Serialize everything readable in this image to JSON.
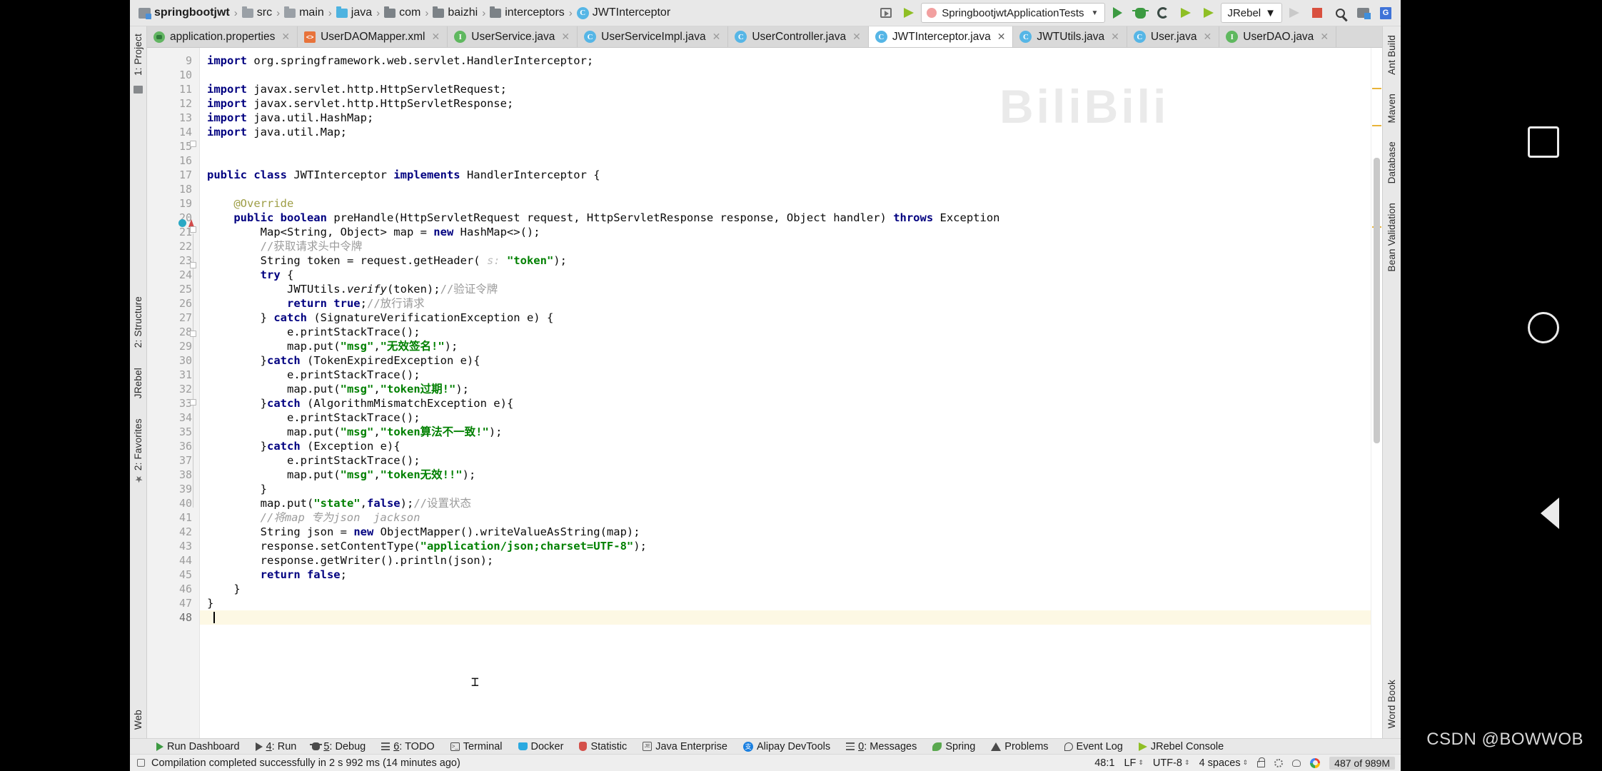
{
  "window": {
    "watermark": "CSDN @BOWWOB",
    "bg_watermark": "BiliBili"
  },
  "navbar": {
    "breadcrumbs": [
      {
        "label": "springbootjwt",
        "icon": "module-icon",
        "bold": true
      },
      {
        "label": "src",
        "icon": "folder-icon"
      },
      {
        "label": "main",
        "icon": "folder-icon"
      },
      {
        "label": "java",
        "icon": "source-folder-icon"
      },
      {
        "label": "com",
        "icon": "package-folder-icon"
      },
      {
        "label": "baizhi",
        "icon": "package-folder-icon"
      },
      {
        "label": "interceptors",
        "icon": "package-folder-icon"
      },
      {
        "label": "JWTInterceptor",
        "icon": "class-icon"
      }
    ],
    "separator": "›",
    "run_config": "SpringbootjwtApplicationTests",
    "jrebel_label": "JRebel",
    "buttons": [
      "run-window-icon",
      "build-hammer-icon",
      "run-icon",
      "debug-icon",
      "coverage-icon",
      "jrebel-run-icon",
      "jrebel-debug-icon",
      "stop-icon-disabled",
      "stop-icon",
      "search-everywhere-icon",
      "project-structure-icon",
      "google-translate-icon"
    ]
  },
  "editor_tabs": [
    {
      "label": "application.properties",
      "icon": "properties-file-icon",
      "active": false,
      "closable": true
    },
    {
      "label": "UserDAOMapper.xml",
      "icon": "xml-file-icon",
      "active": false,
      "closable": true
    },
    {
      "label": "UserService.java",
      "icon": "interface-icon",
      "active": false,
      "closable": true
    },
    {
      "label": "UserServiceImpl.java",
      "icon": "class-icon",
      "active": false,
      "closable": true
    },
    {
      "label": "UserController.java",
      "icon": "class-icon",
      "active": false,
      "closable": true
    },
    {
      "label": "JWTInterceptor.java",
      "icon": "class-icon",
      "active": true,
      "closable": true
    },
    {
      "label": "JWTUtils.java",
      "icon": "class-icon",
      "active": false,
      "closable": true
    },
    {
      "label": "User.java",
      "icon": "class-icon",
      "active": false,
      "closable": true
    },
    {
      "label": "UserDAO.java",
      "icon": "interface-icon",
      "active": false,
      "closable": true
    }
  ],
  "left_tool_strip": {
    "top": [
      "1: Project"
    ],
    "middle": [
      "2: Structure",
      "JRebel",
      "2: Favorites"
    ],
    "bottom": [
      "Web"
    ]
  },
  "right_tool_strip": {
    "top": [
      "Ant Build",
      "Maven",
      "Database",
      "Bean Validation"
    ],
    "bottom": [
      "Word Book"
    ]
  },
  "editor": {
    "first_line": 9,
    "caret_line": 48,
    "lines": [
      {
        "n": 9,
        "tokens": [
          {
            "t": "import",
            "c": "kw"
          },
          {
            "t": " org.springframework.web.servlet.HandlerInterceptor;",
            "c": ""
          }
        ]
      },
      {
        "n": 10,
        "tokens": []
      },
      {
        "n": 11,
        "tokens": [
          {
            "t": "import",
            "c": "kw"
          },
          {
            "t": " javax.servlet.http.HttpServletRequest;",
            "c": ""
          }
        ]
      },
      {
        "n": 12,
        "tokens": [
          {
            "t": "import",
            "c": "kw"
          },
          {
            "t": " javax.servlet.http.HttpServletResponse;",
            "c": ""
          }
        ]
      },
      {
        "n": 13,
        "tokens": [
          {
            "t": "import",
            "c": "kw"
          },
          {
            "t": " java.util.HashMap;",
            "c": ""
          }
        ]
      },
      {
        "n": 14,
        "tokens": [
          {
            "t": "import",
            "c": "kw"
          },
          {
            "t": " java.util.Map;",
            "c": ""
          }
        ]
      },
      {
        "n": 15,
        "tokens": []
      },
      {
        "n": 16,
        "tokens": []
      },
      {
        "n": 17,
        "tokens": [
          {
            "t": "public class",
            "c": "kw"
          },
          {
            "t": " JWTInterceptor ",
            "c": ""
          },
          {
            "t": "implements",
            "c": "kw"
          },
          {
            "t": " HandlerInterceptor {",
            "c": ""
          }
        ]
      },
      {
        "n": 18,
        "tokens": []
      },
      {
        "n": 19,
        "tokens": [
          {
            "t": "    @Override",
            "c": "anno"
          }
        ]
      },
      {
        "n": 20,
        "tokens": [
          {
            "t": "    ",
            "c": ""
          },
          {
            "t": "public boolean",
            "c": "kw"
          },
          {
            "t": " preHandle(HttpServletRequest request, HttpServletResponse response, Object handler) ",
            "c": ""
          },
          {
            "t": "throws",
            "c": "kw"
          },
          {
            "t": " Exception",
            "c": ""
          }
        ]
      },
      {
        "n": 21,
        "tokens": [
          {
            "t": "        Map<String, Object> map = ",
            "c": ""
          },
          {
            "t": "new",
            "c": "kw"
          },
          {
            "t": " HashMap<>();",
            "c": ""
          }
        ]
      },
      {
        "n": 22,
        "tokens": [
          {
            "t": "        //获取请求头中令牌",
            "c": "cmt"
          }
        ]
      },
      {
        "n": 23,
        "tokens": [
          {
            "t": "        String token = request.getHeader( ",
            "c": ""
          },
          {
            "t": "s:",
            "c": "hint"
          },
          {
            "t": " ",
            "c": ""
          },
          {
            "t": "\"token\"",
            "c": "str"
          },
          {
            "t": ");",
            "c": ""
          }
        ]
      },
      {
        "n": 24,
        "tokens": [
          {
            "t": "        ",
            "c": ""
          },
          {
            "t": "try",
            "c": "kw"
          },
          {
            "t": " {",
            "c": ""
          }
        ]
      },
      {
        "n": 25,
        "tokens": [
          {
            "t": "            JWTUtils.",
            "c": ""
          },
          {
            "t": "verify",
            "c": "ital"
          },
          {
            "t": "(token);",
            "c": ""
          },
          {
            "t": "//验证令牌",
            "c": "cmt"
          }
        ]
      },
      {
        "n": 26,
        "tokens": [
          {
            "t": "            ",
            "c": ""
          },
          {
            "t": "return true",
            "c": "kw"
          },
          {
            "t": ";",
            "c": ""
          },
          {
            "t": "//放行请求",
            "c": "cmt"
          }
        ]
      },
      {
        "n": 27,
        "tokens": [
          {
            "t": "        } ",
            "c": ""
          },
          {
            "t": "catch",
            "c": "kw"
          },
          {
            "t": " (SignatureVerificationException e) {",
            "c": ""
          }
        ]
      },
      {
        "n": 28,
        "tokens": [
          {
            "t": "            e.printStackTrace();",
            "c": ""
          }
        ]
      },
      {
        "n": 29,
        "tokens": [
          {
            "t": "            map.put(",
            "c": ""
          },
          {
            "t": "\"msg\"",
            "c": "str"
          },
          {
            "t": ",",
            "c": ""
          },
          {
            "t": "\"无效签名!\"",
            "c": "str"
          },
          {
            "t": ");",
            "c": ""
          }
        ]
      },
      {
        "n": 30,
        "tokens": [
          {
            "t": "        }",
            "c": ""
          },
          {
            "t": "catch",
            "c": "kw"
          },
          {
            "t": " (TokenExpiredException e){",
            "c": ""
          }
        ]
      },
      {
        "n": 31,
        "tokens": [
          {
            "t": "            e.printStackTrace();",
            "c": ""
          }
        ]
      },
      {
        "n": 32,
        "tokens": [
          {
            "t": "            map.put(",
            "c": ""
          },
          {
            "t": "\"msg\"",
            "c": "str"
          },
          {
            "t": ",",
            "c": ""
          },
          {
            "t": "\"token过期!\"",
            "c": "str"
          },
          {
            "t": ");",
            "c": ""
          }
        ]
      },
      {
        "n": 33,
        "tokens": [
          {
            "t": "        }",
            "c": ""
          },
          {
            "t": "catch",
            "c": "kw"
          },
          {
            "t": " (AlgorithmMismatchException e){",
            "c": ""
          }
        ]
      },
      {
        "n": 34,
        "tokens": [
          {
            "t": "            e.printStackTrace();",
            "c": ""
          }
        ]
      },
      {
        "n": 35,
        "tokens": [
          {
            "t": "            map.put(",
            "c": ""
          },
          {
            "t": "\"msg\"",
            "c": "str"
          },
          {
            "t": ",",
            "c": ""
          },
          {
            "t": "\"token算法不一致!\"",
            "c": "str"
          },
          {
            "t": ");",
            "c": ""
          }
        ]
      },
      {
        "n": 36,
        "tokens": [
          {
            "t": "        }",
            "c": ""
          },
          {
            "t": "catch",
            "c": "kw"
          },
          {
            "t": " (Exception e){",
            "c": ""
          }
        ]
      },
      {
        "n": 37,
        "tokens": [
          {
            "t": "            e.printStackTrace();",
            "c": ""
          }
        ]
      },
      {
        "n": 38,
        "tokens": [
          {
            "t": "            map.put(",
            "c": ""
          },
          {
            "t": "\"msg\"",
            "c": "str"
          },
          {
            "t": ",",
            "c": ""
          },
          {
            "t": "\"token无效!!\"",
            "c": "str"
          },
          {
            "t": ");",
            "c": ""
          }
        ]
      },
      {
        "n": 39,
        "tokens": [
          {
            "t": "        }",
            "c": ""
          }
        ]
      },
      {
        "n": 40,
        "tokens": [
          {
            "t": "        map.put(",
            "c": ""
          },
          {
            "t": "\"state\"",
            "c": "str"
          },
          {
            "t": ",",
            "c": ""
          },
          {
            "t": "false",
            "c": "kw"
          },
          {
            "t": ");",
            "c": ""
          },
          {
            "t": "//设置状态",
            "c": "cmt"
          }
        ]
      },
      {
        "n": 41,
        "tokens": [
          {
            "t": "        //将map 专为json  jackson",
            "c": "cmt-i"
          }
        ]
      },
      {
        "n": 42,
        "tokens": [
          {
            "t": "        String json = ",
            "c": ""
          },
          {
            "t": "new",
            "c": "kw"
          },
          {
            "t": " ObjectMapper().writeValueAsString(map);",
            "c": ""
          }
        ]
      },
      {
        "n": 43,
        "tokens": [
          {
            "t": "        response.setContentType(",
            "c": ""
          },
          {
            "t": "\"application/json;charset=UTF-8\"",
            "c": "str"
          },
          {
            "t": ");",
            "c": ""
          }
        ]
      },
      {
        "n": 44,
        "tokens": [
          {
            "t": "        response.getWriter().println(json);",
            "c": ""
          }
        ]
      },
      {
        "n": 45,
        "tokens": [
          {
            "t": "        ",
            "c": ""
          },
          {
            "t": "return false",
            "c": "kw"
          },
          {
            "t": ";",
            "c": ""
          }
        ]
      },
      {
        "n": 46,
        "tokens": [
          {
            "t": "    }",
            "c": ""
          }
        ]
      },
      {
        "n": 47,
        "tokens": [
          {
            "t": "}",
            "c": ""
          }
        ]
      },
      {
        "n": 48,
        "tokens": []
      }
    ]
  },
  "bottom_bar": [
    {
      "label": "Run Dashboard",
      "icon": "run-dashboard-icon",
      "mnemonic": ""
    },
    {
      "label": "Run",
      "icon": "run-icon",
      "mnemonic": "4"
    },
    {
      "label": "Debug",
      "icon": "debug-icon",
      "mnemonic": "5"
    },
    {
      "label": "TODO",
      "icon": "todo-icon",
      "mnemonic": "6"
    },
    {
      "label": "Terminal",
      "icon": "terminal-icon",
      "mnemonic": ""
    },
    {
      "label": "Docker",
      "icon": "docker-icon",
      "mnemonic": ""
    },
    {
      "label": "Statistic",
      "icon": "statistic-icon",
      "mnemonic": ""
    },
    {
      "label": "Java Enterprise",
      "icon": "java-enterprise-icon",
      "mnemonic": ""
    },
    {
      "label": "Alipay DevTools",
      "icon": "alipay-icon",
      "mnemonic": ""
    },
    {
      "label": "Messages",
      "icon": "messages-icon",
      "mnemonic": "0"
    },
    {
      "label": "Spring",
      "icon": "spring-icon",
      "mnemonic": ""
    },
    {
      "label": "Problems",
      "icon": "problems-icon",
      "mnemonic": ""
    },
    {
      "label": "Event Log",
      "icon": "event-log-icon",
      "mnemonic": ""
    },
    {
      "label": "JRebel Console",
      "icon": "jrebel-icon",
      "mnemonic": ""
    }
  ],
  "status_bar": {
    "message": "Compilation completed successfully in 2 s 992 ms (14 minutes ago)",
    "caret_position": "48:1",
    "line_separator": "LF",
    "encoding": "UTF-8",
    "indent": "4 spaces",
    "memory": "487 of 989M",
    "icons": [
      "lock-icon",
      "code-style-icon",
      "inspection-icon",
      "google-icon"
    ]
  }
}
